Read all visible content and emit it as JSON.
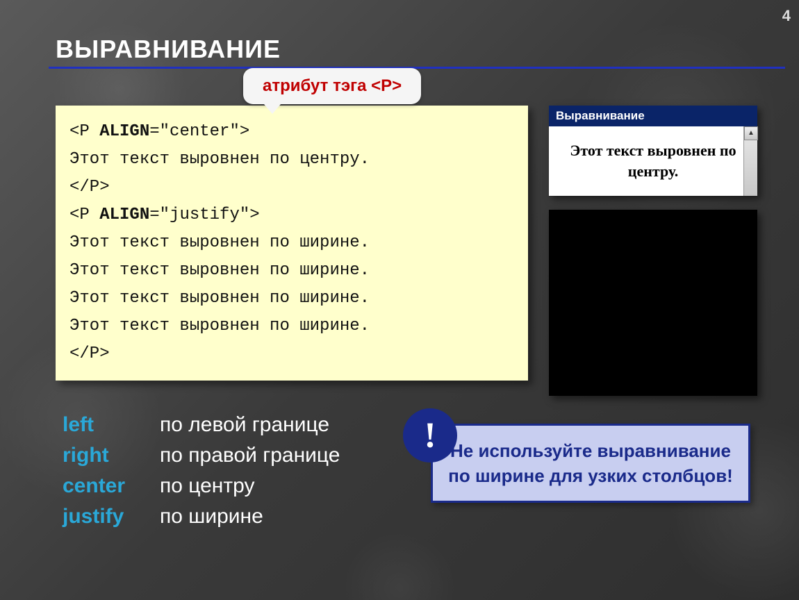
{
  "page_number": "4",
  "title": "ВЫРАВНИВАНИЕ",
  "callout": "атрибут тэга <P>",
  "code": {
    "l1a": "<P ",
    "l1b": "ALIGN",
    "l1c": "=\"center\">",
    "l2": "Этот текст выровнен по центру.",
    "l3": "</P>",
    "l4a": "<P ",
    "l4b": "ALIGN",
    "l4c": "=\"justify\">",
    "l5": "Этот текст выровнен по ширине.",
    "l6": "Этот текст выровнен по ширине.",
    "l7": "Этот текст выровнен по ширине.",
    "l8": "Этот текст выровнен по ширине.",
    "l9": "</P>"
  },
  "align_options": [
    {
      "kw": "left",
      "desc": "по левой границе"
    },
    {
      "kw": "right",
      "desc": "по правой границе"
    },
    {
      "kw": "center",
      "desc": "по центру"
    },
    {
      "kw": "justify",
      "desc": "по ширине"
    }
  ],
  "warning": {
    "badge": "!",
    "text": "Не используйте выравнивание по ширине для узких столбцов!"
  },
  "preview": {
    "title": "Выравнивание",
    "body": "Этот текст выровнен по центру.",
    "scroll_up": "▲"
  }
}
